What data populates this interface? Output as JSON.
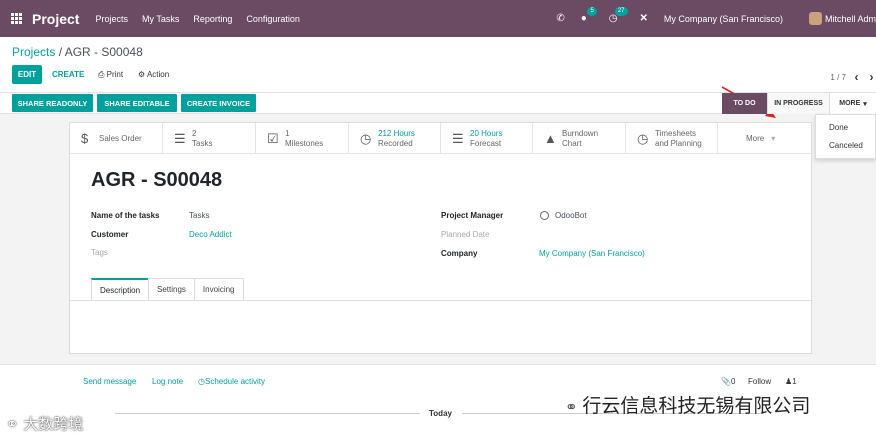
{
  "navbar": {
    "brand": "Project",
    "menu": [
      "Projects",
      "My Tasks",
      "Reporting",
      "Configuration"
    ],
    "messages_badge": "5",
    "activities_badge": "27",
    "company": "My Company (San Francisco)",
    "user": "Mitchell Adm"
  },
  "control": {
    "breadcrumb_root": "Projects",
    "breadcrumb_sep": " / ",
    "breadcrumb_current": "AGR - S00048",
    "edit_label": "EDIT",
    "create_label": "CREATE",
    "print_label": "Print",
    "action_label": "Action",
    "pager": "1 / 7"
  },
  "statusbar": {
    "buttons": [
      "SHARE READONLY",
      "SHARE EDITABLE",
      "CREATE INVOICE"
    ],
    "stages": [
      "TO DO",
      "IN PROGRESS",
      "MORE"
    ],
    "dropdown": [
      "Done",
      "Canceled"
    ]
  },
  "smart_buttons": [
    {
      "icon": "dollar-icon",
      "line1": "Sales Order",
      "line2": ""
    },
    {
      "icon": "tasks-icon",
      "line1": "2",
      "line2": "Tasks"
    },
    {
      "icon": "milestone-icon",
      "line1": "1",
      "line2": "Milestones"
    },
    {
      "icon": "clock-icon",
      "line1": "212 Hours",
      "line2": "Recorded"
    },
    {
      "icon": "forecast-icon",
      "line1": "20 Hours",
      "line2": "Forecast"
    },
    {
      "icon": "chart-icon",
      "line1": "Burndown",
      "line2": "Chart"
    },
    {
      "icon": "timesheet-icon",
      "line1": "Timesheets",
      "line2": "and Planning"
    },
    {
      "icon": "",
      "line1": "More",
      "line2": ""
    }
  ],
  "form": {
    "title": "AGR - S00048",
    "name_label": "Name of the tasks",
    "name_value": "Tasks",
    "customer_label": "Customer",
    "customer_value": "Deco Addict",
    "tags_placeholder": "Tags",
    "manager_label": "Project Manager",
    "manager_value": "OdooBot",
    "planned_label": "Planned Date",
    "company_label": "Company",
    "company_value": "My Company (San Francisco)",
    "tabs": [
      "Description",
      "Settings",
      "Invoicing"
    ]
  },
  "chatter": {
    "send_message": "Send message",
    "log_note": "Log note",
    "schedule_activity": "Schedule activity",
    "attachments": "0",
    "follow": "Follow",
    "followers": "1",
    "today": "Today"
  },
  "watermarks": {
    "left": "大数跨境",
    "right": "行云信息科技无锡有限公司"
  },
  "colors": {
    "navbar": "#6b4a63",
    "accent": "#00a09d",
    "arrow": "#e02020"
  }
}
